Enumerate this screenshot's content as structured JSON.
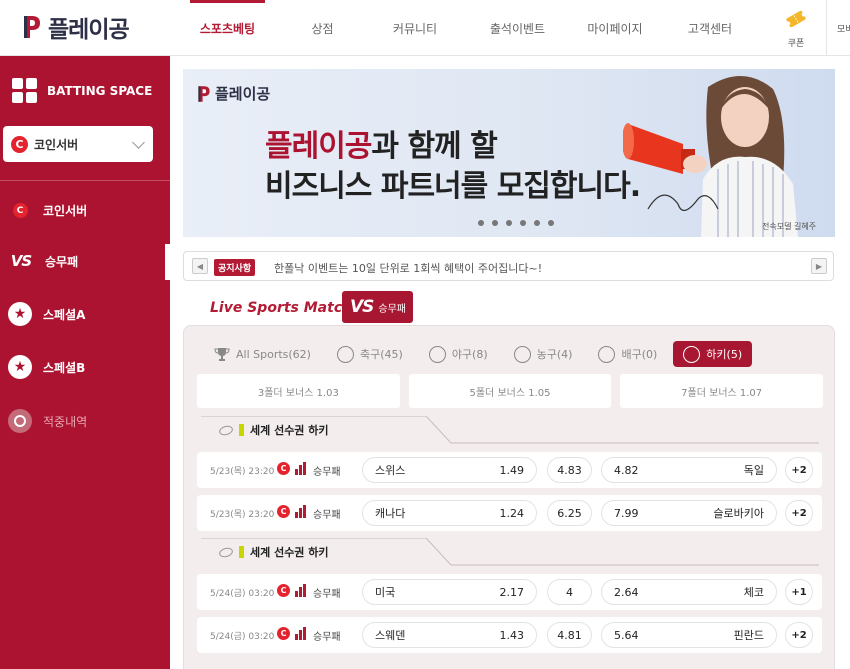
{
  "header": {
    "logo": "플레이공",
    "nav": [
      "스포츠베팅",
      "상점",
      "커뮤니티",
      "출석이벤트",
      "마이페이지",
      "고객센터"
    ],
    "active_nav": "스포츠베팅",
    "coupon_label": "쿠폰",
    "mobile_label": "모바"
  },
  "sidebar": {
    "brand": "BATTING SPACE",
    "selected": "코인서버",
    "items": [
      {
        "label": "코인서버",
        "icon": "coin-c-icon"
      },
      {
        "label": "승무패",
        "icon": "vs-icon"
      },
      {
        "label": "스페셜A",
        "icon": "star-icon"
      },
      {
        "label": "스페셜B",
        "icon": "star-icon"
      },
      {
        "label": "적중내역",
        "icon": "target-icon"
      }
    ]
  },
  "banner": {
    "logo": "플레이공",
    "line1_highlight": "플레이공",
    "line1_rest": "과 함께 할",
    "line2": "비즈니스 파트너를 모집합니다.",
    "caption": "전속모델 길혜주",
    "slides": 6
  },
  "notice": {
    "badge": "공지사항",
    "text": "한폴낙 이벤트는 10일 단위로 1회씩 혜택이 주어집니다~!"
  },
  "live": {
    "title": "Live Sports Match",
    "badge_vs": "VS",
    "badge_label": "승무패"
  },
  "sport_tabs": [
    {
      "label": "All Sports(62)",
      "icon": "trophy-icon"
    },
    {
      "label": "축구(45)",
      "icon": "soccer-ball-icon"
    },
    {
      "label": "야구(8)",
      "icon": "baseball-icon"
    },
    {
      "label": "농구(4)",
      "icon": "basketball-icon"
    },
    {
      "label": "배구(0)",
      "icon": "volleyball-icon"
    },
    {
      "label": "하키(5)",
      "icon": "hockey-icon",
      "active": true
    }
  ],
  "bonuses": [
    "3폴더 보너스 1.03",
    "5폴더 보너스 1.05",
    "7폴더 보너스 1.07"
  ],
  "leagues": [
    {
      "name": "세계 선수권 하키",
      "matches": [
        {
          "time": "5/23(목) 23:20",
          "type": "승무패",
          "home": "스위스",
          "home_odd": "1.49",
          "draw": "4.83",
          "away_odd": "4.82",
          "away": "독일",
          "more": "+2"
        },
        {
          "time": "5/23(목) 23:20",
          "type": "승무패",
          "home": "캐나다",
          "home_odd": "1.24",
          "draw": "6.25",
          "away_odd": "7.99",
          "away": "슬로바키아",
          "more": "+2"
        }
      ]
    },
    {
      "name": "세계 선수권 하키",
      "matches": [
        {
          "time": "5/24(금) 03:20",
          "type": "승무패",
          "home": "미국",
          "home_odd": "2.17",
          "draw": "4",
          "away_odd": "2.64",
          "away": "체코",
          "more": "+1"
        },
        {
          "time": "5/24(금) 03:20",
          "type": "승무패",
          "home": "스웨덴",
          "home_odd": "1.43",
          "draw": "4.81",
          "away_odd": "5.64",
          "away": "핀란드",
          "more": "+2"
        }
      ]
    }
  ],
  "colors": {
    "brand": "#ab1330",
    "accent": "#b31b34",
    "coin": "#e4232f"
  }
}
